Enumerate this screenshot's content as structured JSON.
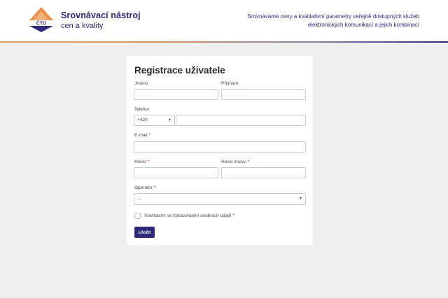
{
  "header": {
    "logo_text": "ČTÚ",
    "brand_title": "Srovnávací nástroj",
    "brand_subtitle": "cen a kvality",
    "tagline": "Srovnáváme ceny a kvalitativní parametry veřejně dostupných služeb elektronických komunikací a jejich kombinací",
    "colors": {
      "primary": "#2d2a7a",
      "accent": "#e8a060"
    }
  },
  "form": {
    "title": "Registrace uživatele",
    "first_name_label": "Jméno",
    "last_name_label": "Příjmení",
    "phone_label": "Telefon",
    "phone_prefix": "+420",
    "email_label": "E-mail",
    "password_label": "Heslo",
    "password_again_label": "Heslo znovu",
    "operator_label": "Operátor",
    "operator_value": "---",
    "consent_label": "Souhlasím se zpracováním osobních údajů",
    "required_marker": "*",
    "save_label": "Uložit"
  }
}
